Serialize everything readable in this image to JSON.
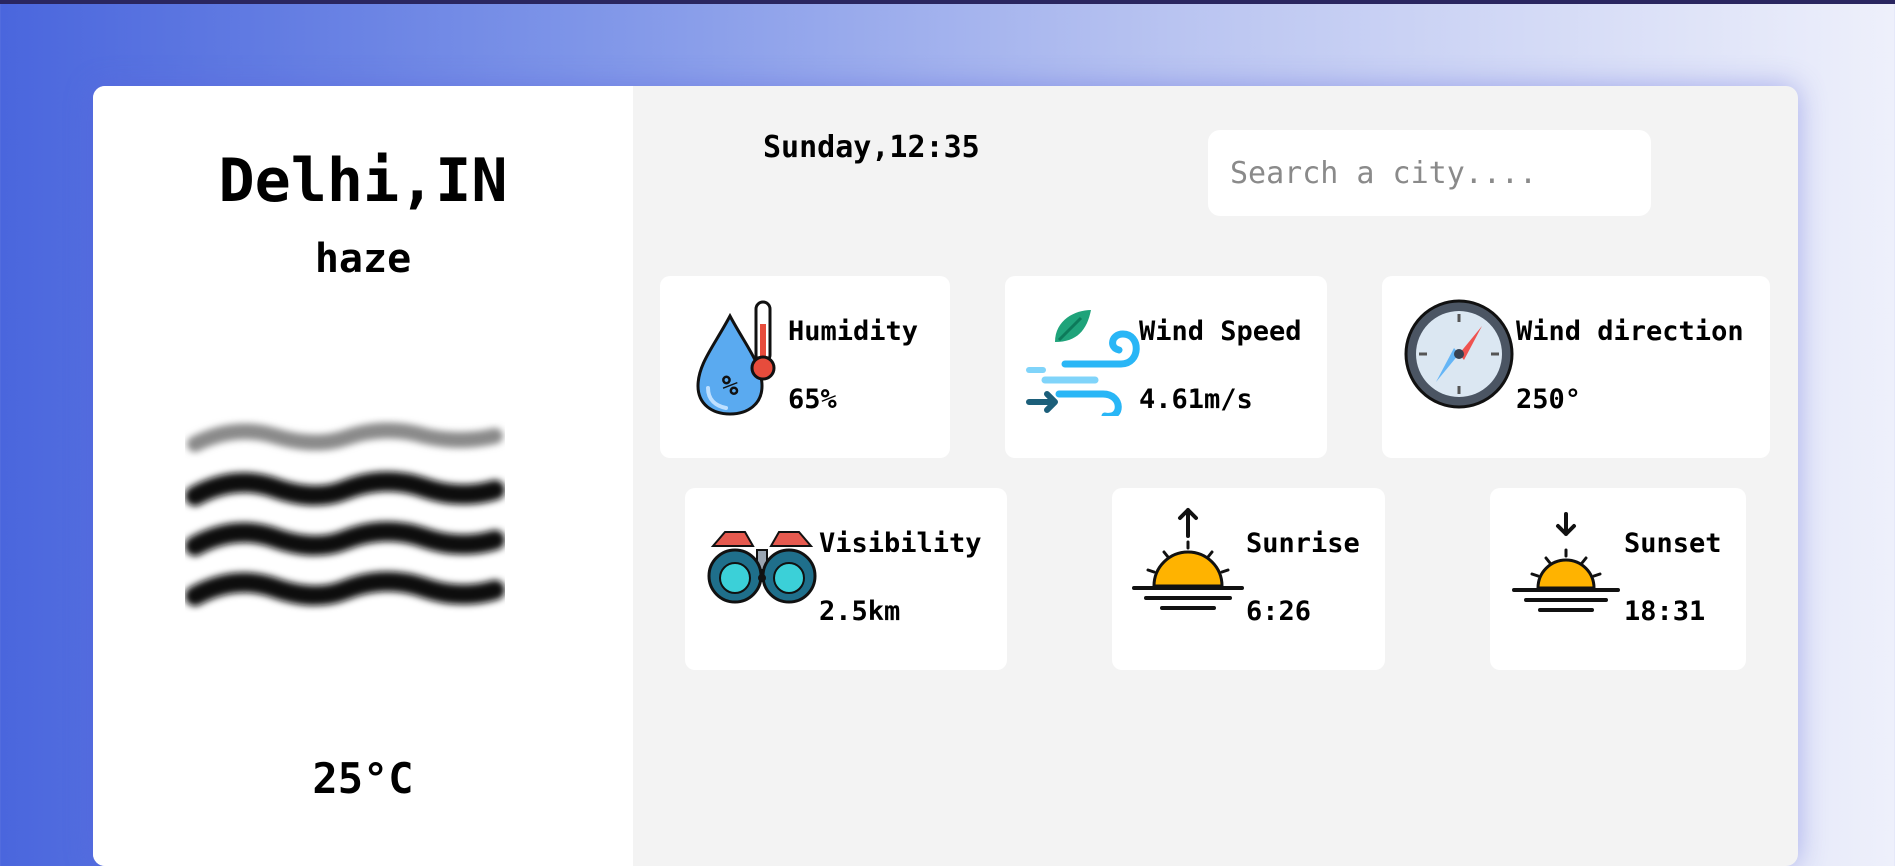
{
  "location": {
    "city": "Delhi,IN"
  },
  "weather": {
    "condition": "haze",
    "temperature": "25°C",
    "icon": "haze-icon"
  },
  "header": {
    "datetime": "Sunday,12:35"
  },
  "search": {
    "placeholder": "Search a city...."
  },
  "stats": {
    "humidity": {
      "label": "Humidity",
      "value": "65%",
      "icon": "humidity-icon"
    },
    "wind_speed": {
      "label": "Wind Speed",
      "value": "4.61m/s",
      "icon": "wind-icon"
    },
    "wind_direction": {
      "label": "Wind direction",
      "value": "250°",
      "icon": "compass-icon"
    },
    "visibility": {
      "label": "Visibility",
      "value": "2.5km",
      "icon": "binoculars-icon"
    },
    "sunrise": {
      "label": "Sunrise",
      "value": "6:26",
      "icon": "sunrise-icon"
    },
    "sunset": {
      "label": "Sunset",
      "value": "18:31",
      "icon": "sunset-icon"
    }
  },
  "colors": {
    "background_start": "#4a66dd",
    "background_end": "#eef0fb",
    "card": "#f3f3f3",
    "tile": "#ffffff",
    "sun": "#ffb300"
  }
}
